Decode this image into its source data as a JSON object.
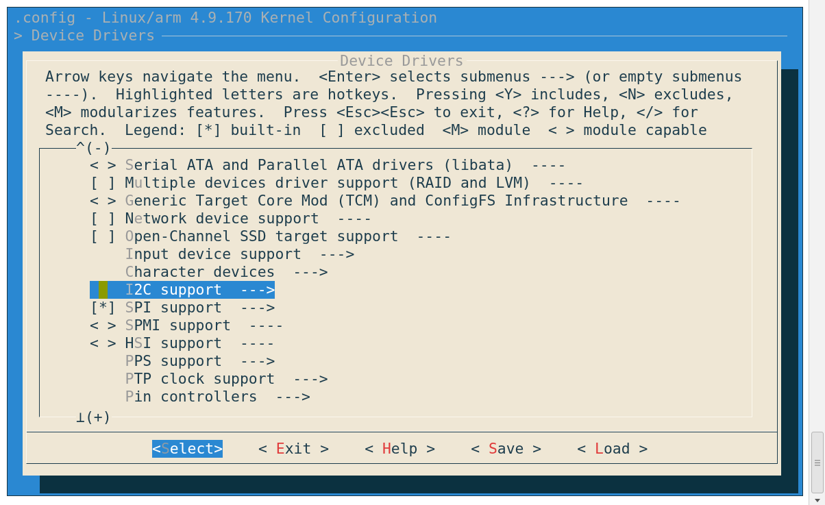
{
  "window": {
    "title": ".config - Linux/arm 4.9.170 Kernel Configuration",
    "breadcrumb": "> Device Drivers"
  },
  "dialog": {
    "title": "Device Drivers",
    "help_lines": [
      "Arrow keys navigate the menu.  <Enter> selects submenus ---> (or empty submenus",
      "----).  Highlighted letters are hotkeys.  Pressing <Y> includes, <N> excludes,",
      "<M> modularizes features.  Press <Esc><Esc> to exit, <?> for Help, </> for",
      "Search.  Legend: [*] built-in  [ ] excluded  <M> module  < > module capable"
    ],
    "scroll_up": "^(-)",
    "scroll_down": "⊥(+)"
  },
  "items": [
    {
      "prefix": "< >",
      "hotkey": "S",
      "tail": "erial ATA and Parallel ATA drivers (libata)  ----",
      "selected": false
    },
    {
      "prefix": "[ ]",
      "lead": "M",
      "hotkey": "u",
      "tail": "ltiple devices driver support (RAID and LVM)  ----",
      "selected": false
    },
    {
      "prefix": "< >",
      "hotkey": "G",
      "tail": "eneric Target Core Mod (TCM) and ConfigFS Infrastructure  ----",
      "selected": false
    },
    {
      "prefix": "[ ]",
      "lead": "N",
      "hotkey": "e",
      "tail": "twork device support  ----",
      "selected": false
    },
    {
      "prefix": "[ ]",
      "hotkey": "O",
      "tail": "pen-Channel SSD target support  ----",
      "selected": false
    },
    {
      "hotkey": "I",
      "tail": "nput device support  --->",
      "selected": false
    },
    {
      "hotkey": "C",
      "tail": "haracter devices  --->",
      "selected": false
    },
    {
      "hotkey": "I",
      "tail": "2C support  --->",
      "selected": true
    },
    {
      "prefix": "[*]",
      "hotkey": "S",
      "tail": "PI support  --->",
      "selected": false
    },
    {
      "prefix": "< >",
      "hotkey": "S",
      "tail": "PMI support  ----",
      "selected": false
    },
    {
      "prefix": "< >",
      "lead": "H",
      "hotkey": "S",
      "tail": "I support  ----",
      "selected": false
    },
    {
      "hotkey": "P",
      "tail": "PS support  --->",
      "selected": false
    },
    {
      "hotkey": "P",
      "tail": "TP clock support  --->",
      "selected": false
    },
    {
      "hotkey": "P",
      "tail": "in controllers  --->",
      "selected": false
    }
  ],
  "buttons": [
    {
      "before": "<",
      "hotkey": "S",
      "after": "elect>",
      "selected": true
    },
    {
      "before": "< ",
      "hotkey": "E",
      "after": "xit >",
      "selected": false
    },
    {
      "before": "< ",
      "hotkey": "H",
      "after": "elp >",
      "selected": false
    },
    {
      "before": "< ",
      "hotkey": "S",
      "after": "ave >",
      "selected": false
    },
    {
      "before": "< ",
      "hotkey": "L",
      "after": "oad >",
      "selected": false
    }
  ]
}
